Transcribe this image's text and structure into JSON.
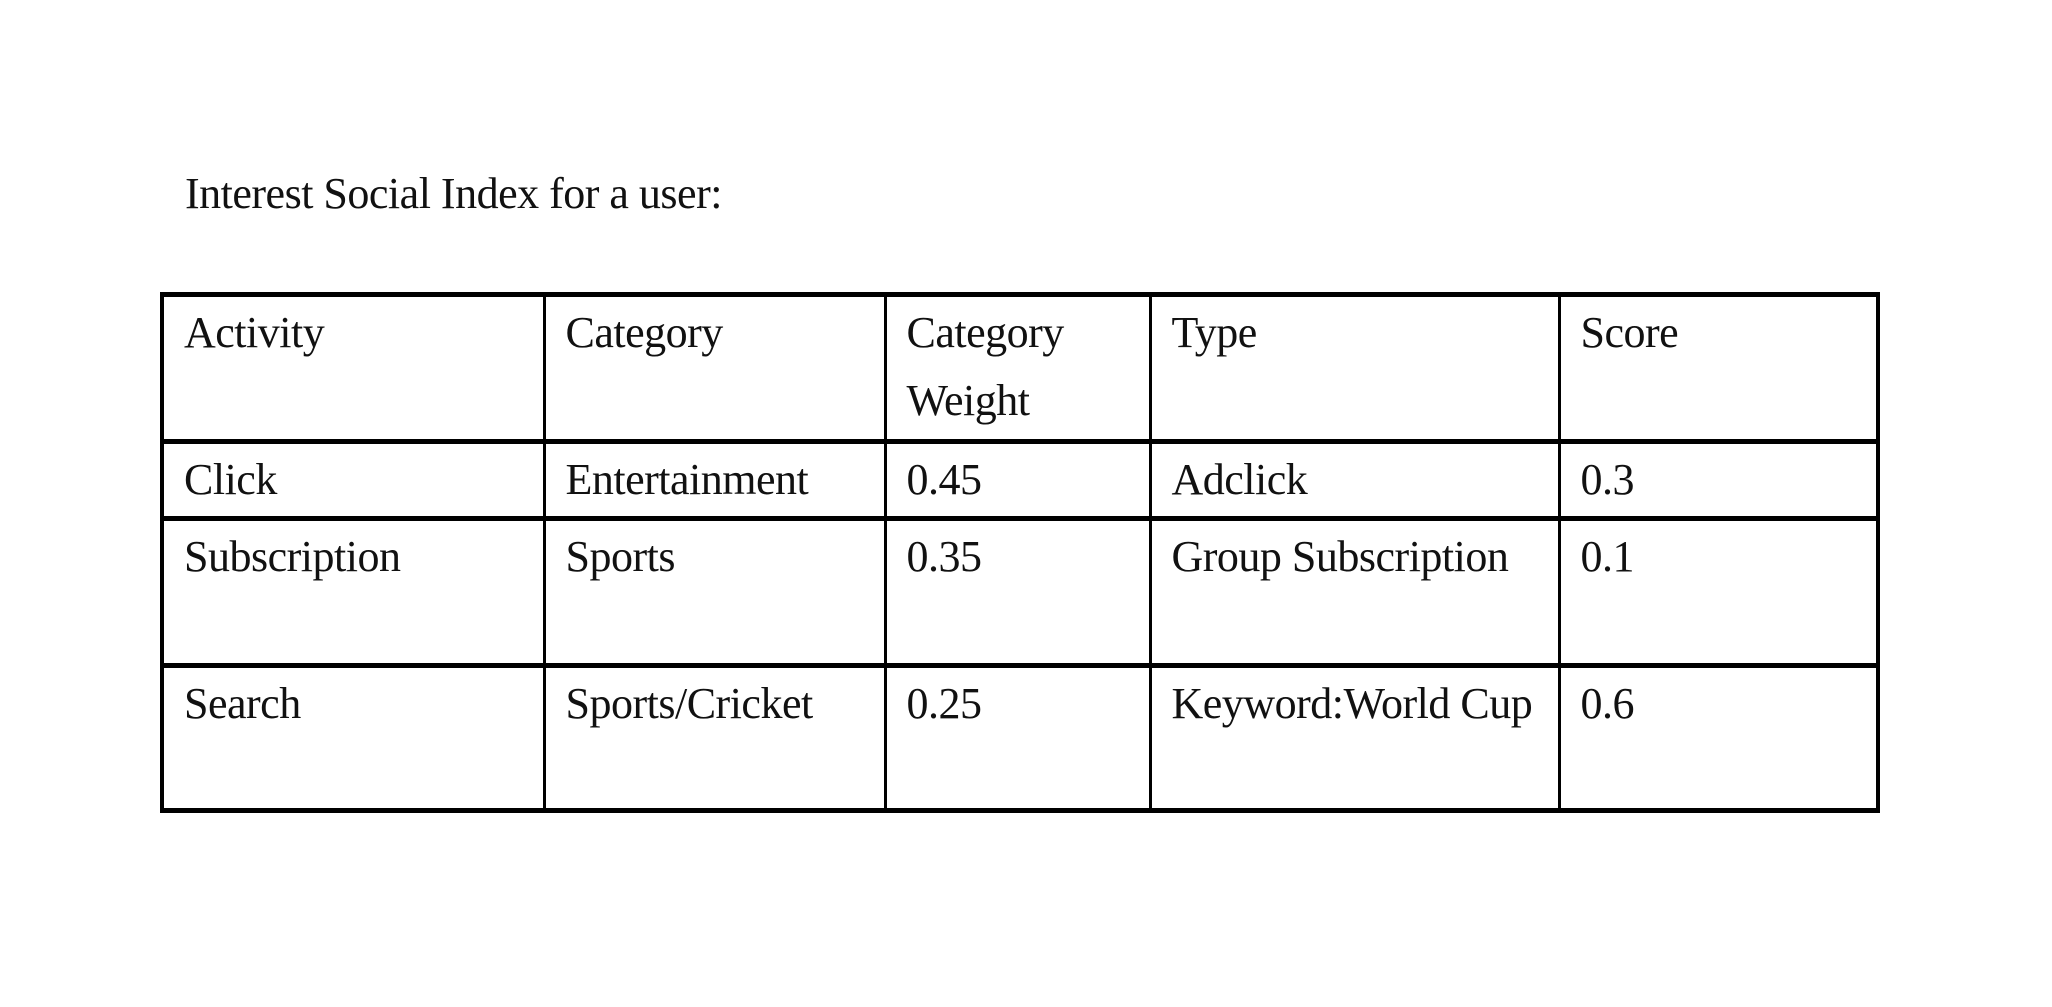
{
  "title": "Interest Social Index for a user:",
  "table": {
    "headers": [
      "Activity",
      "Category",
      "Category Weight",
      "Type",
      "Score"
    ],
    "rows": [
      [
        "Click",
        "Entertainment",
        "0.45",
        "Adclick",
        "0.3"
      ],
      [
        "Subscription",
        "Sports",
        "0.35",
        "Group Subscription",
        "0.1"
      ],
      [
        "Search",
        "Sports/Cricket",
        "0.25",
        "Keyword:World Cup",
        "0.6"
      ]
    ]
  }
}
